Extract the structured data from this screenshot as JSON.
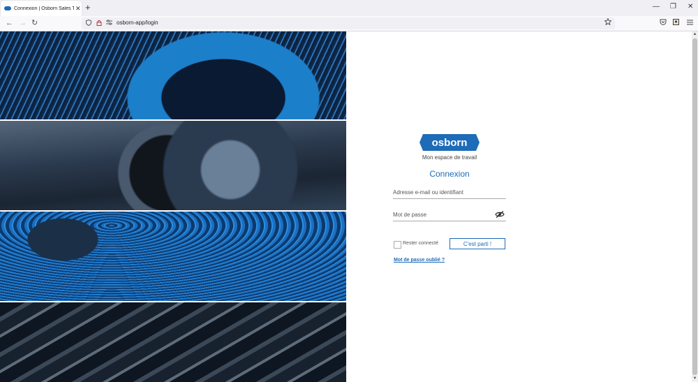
{
  "browser": {
    "tab_title": "Connexion | Osborn Sales Tool",
    "tab_close": "✕",
    "new_tab": "+",
    "url": "osborn-app/login",
    "window_controls": {
      "minimize": "—",
      "restore": "❐",
      "close": "✕"
    },
    "nav": {
      "back": "←",
      "forward": "→",
      "reload": "↻"
    },
    "icons": {
      "shield": "shield-icon",
      "lock": "lock-icon",
      "permissions": "permissions-icon",
      "star": "star-icon",
      "pocket": "pocket-icon",
      "extensions": "extensions-icon",
      "menu": "menu-icon"
    }
  },
  "login": {
    "logo_text": "osborn",
    "subtitle": "Mon espace de travail",
    "heading": "Connexion",
    "email_placeholder": "Adresse e-mail ou identifiant",
    "password_placeholder": "Mot de passe",
    "remember_label": "Rester connecté",
    "submit_label": "C'est parti !",
    "forgot_link": "Mot de passe oublié ?"
  },
  "colors": {
    "brand_blue": "#1e6bb8"
  }
}
